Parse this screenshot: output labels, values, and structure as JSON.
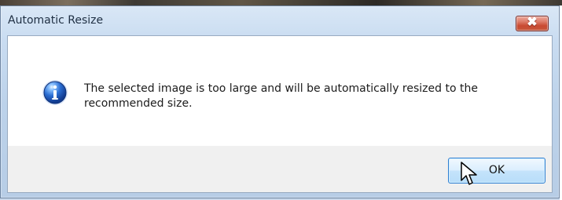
{
  "window": {
    "title": "Automatic Resize",
    "close_label": "✖"
  },
  "message": {
    "text": "The selected image is too large and will be automatically resized to the recommended size.",
    "icon": "info-icon"
  },
  "buttons": {
    "ok_label": "OK"
  },
  "cursor": {
    "icon": "mouse-pointer-icon"
  },
  "colors": {
    "titlebar": "#c9dcf1",
    "dialog_background": "#f0f0f0",
    "message_background": "#ffffff",
    "close_button": "#c94b32",
    "ok_button_border": "#2f7fd1",
    "info_icon": "#1f5fbf"
  }
}
